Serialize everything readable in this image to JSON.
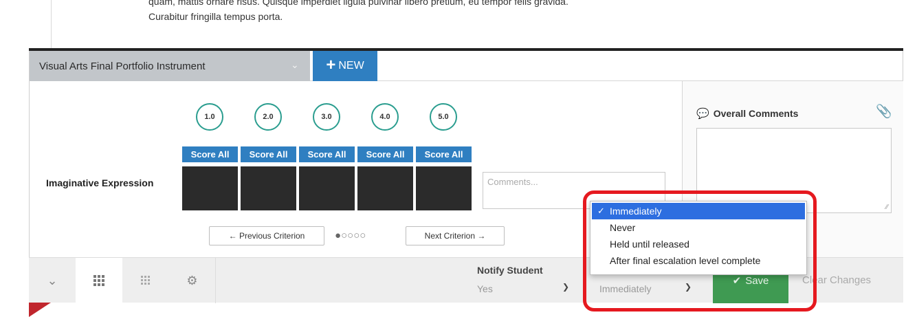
{
  "intro": {
    "line1": "quam, mattis ornare risus. Quisque imperdiet ligula pulvinar libero pretium, eu tempor felis gravida.",
    "line2": "Curabitur fringilla tempus porta."
  },
  "toolbar": {
    "instrument_value": "Visual Arts Final Portfolio Instrument",
    "new_label": "NEW"
  },
  "rubric": {
    "levels": [
      "1.0",
      "2.0",
      "3.0",
      "4.0",
      "5.0"
    ],
    "score_all_label": "Score All",
    "criterion": "Imaginative Expression",
    "comments_placeholder": "Comments...",
    "prev_label": "← Previous Criterion",
    "next_label": "Next Criterion →",
    "pagination": {
      "current": 1,
      "total": 5
    }
  },
  "overall_comments": {
    "label": "Overall Comments"
  },
  "bottom": {
    "notify_label": "Notify Student",
    "notify_value": "Yes",
    "release_value": "Immediately",
    "save_label": "Save",
    "clear_label": "Clear Changes"
  },
  "dropdown": {
    "options": [
      "Immediately",
      "Never",
      "Held until released",
      "After final escalation level complete"
    ],
    "selected": "Immediately"
  },
  "colors": {
    "accent": "#2f7fc1",
    "level_ring": "#2a9d8f",
    "save": "#3f9a52",
    "highlight": "#e5191f"
  }
}
